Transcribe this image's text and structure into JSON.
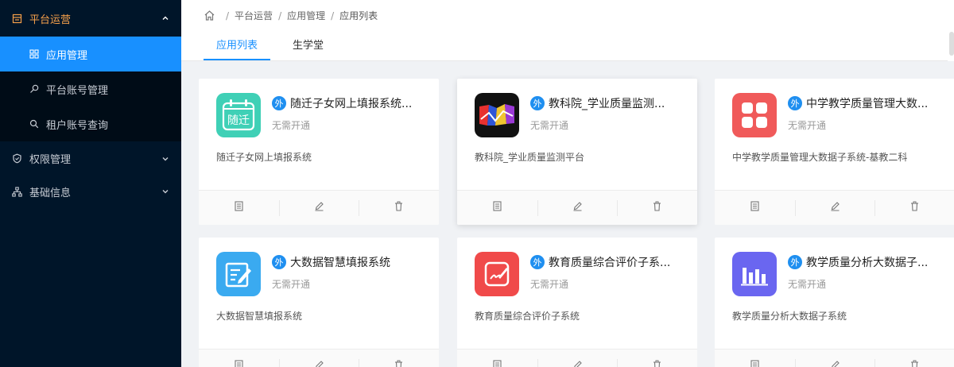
{
  "sidebar": {
    "groups": [
      {
        "label": "平台运营",
        "icon": "building-icon",
        "open": true,
        "items": [
          {
            "label": "应用管理",
            "icon": "grid-icon",
            "active": true
          },
          {
            "label": "平台账号管理",
            "icon": "search-key-icon"
          },
          {
            "label": "租户账号查询",
            "icon": "search-icon"
          }
        ]
      },
      {
        "label": "权限管理",
        "icon": "shield-icon"
      },
      {
        "label": "基础信息",
        "icon": "org-tree-icon"
      }
    ]
  },
  "breadcrumb": [
    "平台运营",
    "应用管理",
    "应用列表"
  ],
  "tabs": [
    {
      "label": "应用列表",
      "active": true
    },
    {
      "label": "生学堂"
    }
  ],
  "cards": [
    {
      "badge": "外",
      "title": "随迁子女网上填报系统...",
      "status": "无需开通",
      "desc": "随迁子女网上填报系统",
      "icon_text": "随迁",
      "icon_name": "calendar-app-icon",
      "color": "#3fd0b6"
    },
    {
      "badge": "外",
      "title": "教科院_学业质量监测...",
      "status": "无需开通",
      "desc": "教科院_学业质量监测平台",
      "icon_name": "colorful-logo-icon",
      "color": "#111111"
    },
    {
      "badge": "外",
      "title": "中学教学质量管理大数...",
      "status": "无需开通",
      "desc": "中学教学质量管理大数据子系统-基教二科",
      "icon_name": "four-squares-icon",
      "color": "#f05a5a"
    },
    {
      "badge": "外",
      "title": "大数据智慧填报系统",
      "status": "无需开通",
      "desc": "大数据智慧填报系统",
      "icon_name": "edit-note-icon",
      "color": "#3aaaf0"
    },
    {
      "badge": "外",
      "title": "教育质量综合评价子系...",
      "status": "无需开通",
      "desc": "教育质量综合评价子系统",
      "icon_name": "signature-icon",
      "color": "#f04a4a"
    },
    {
      "badge": "外",
      "title": "教学质量分析大数据子...",
      "status": "无需开通",
      "desc": "教学质量分析大数据子系统",
      "icon_name": "bar-chart-icon",
      "color": "#6a66f0"
    }
  ],
  "colors": {
    "accent": "#1890ff",
    "sidebar_bg": "#001529",
    "open_group": "#f5a04a"
  }
}
